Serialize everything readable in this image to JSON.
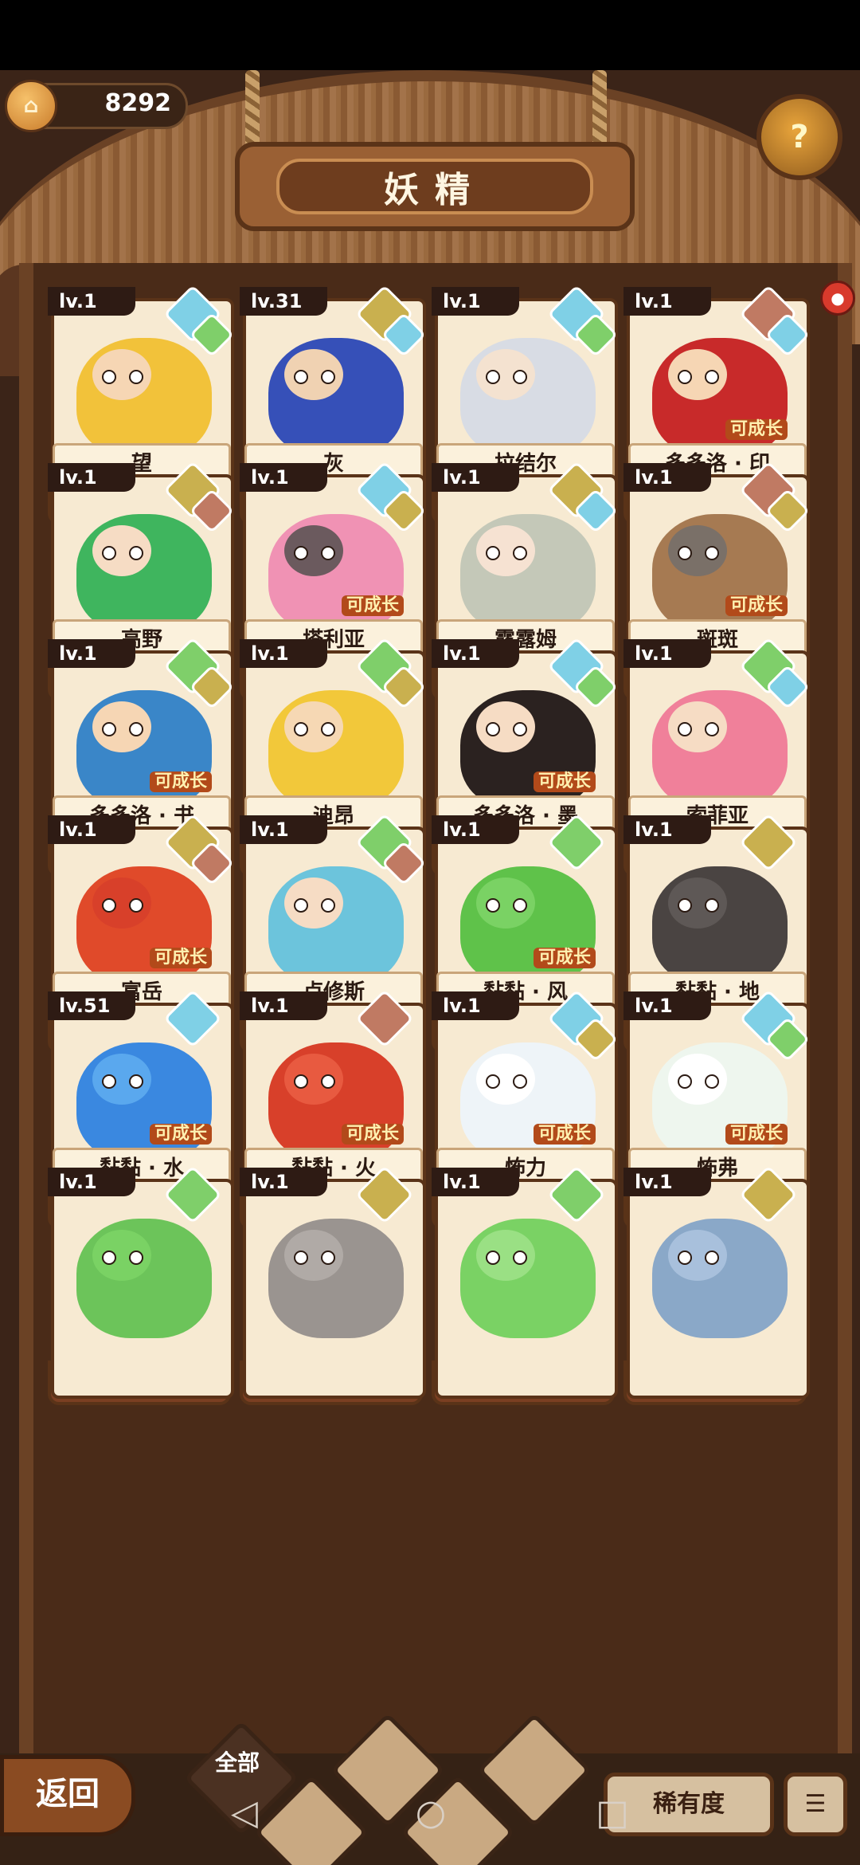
{
  "header": {
    "coins": "8292",
    "title": "妖精",
    "help_icon": "question-sprout-icon"
  },
  "colors": {
    "wood": "#8a5a33",
    "card": "#f7ead2",
    "star": "#ffd447",
    "water": "#7fd0e6",
    "earth": "#c9b04f",
    "grass": "#7fcf6a",
    "fire": "#c07a63"
  },
  "cards": [
    {
      "level": "lv.1",
      "name": "望",
      "stars": "★★★★★",
      "grow": "",
      "hair": "#f2c23a",
      "skin": "#f6d6b4",
      "e1": "water",
      "e2": "grass"
    },
    {
      "level": "lv.31",
      "name": "灰",
      "stars": "★★★★★",
      "grow": "",
      "hair": "#3650b8",
      "skin": "#f0d2b2",
      "e1": "earth",
      "e2": "water"
    },
    {
      "level": "lv.1",
      "name": "拉结尔",
      "stars": "★★★★★",
      "grow": "",
      "hair": "#d8dce4",
      "skin": "#f4e2d0",
      "e1": "water",
      "e2": "grass"
    },
    {
      "level": "lv.1",
      "name": "多多洛 · 印",
      "stars": "★★★★",
      "grow": "可成长",
      "hair": "#c82a2a",
      "skin": "#f6d6b4",
      "e1": "fire",
      "e2": "water"
    },
    {
      "level": "lv.1",
      "name": "高野",
      "stars": "★★★★",
      "grow": "",
      "hair": "#3fb55e",
      "skin": "#f6dcc4",
      "e1": "earth",
      "e2": "fire"
    },
    {
      "level": "lv.1",
      "name": "塔利亚",
      "stars": "★★★★",
      "grow": "可成长",
      "hair": "#f092b4",
      "skin": "#6b5a5e",
      "e1": "water",
      "e2": "earth"
    },
    {
      "level": "lv.1",
      "name": "露露姆",
      "stars": "★★★★",
      "grow": "",
      "hair": "#c4c8b8",
      "skin": "#f6e2d2",
      "e1": "earth",
      "e2": "water"
    },
    {
      "level": "lv.1",
      "name": "斑斑",
      "stars": "★★★★",
      "grow": "可成长",
      "hair": "#a67a52",
      "skin": "#7a7068",
      "e1": "fire",
      "e2": "earth"
    },
    {
      "level": "lv.1",
      "name": "多多洛 · 书",
      "stars": "★★★",
      "grow": "可成长",
      "hair": "#3a86c8",
      "skin": "#f6d6b4",
      "e1": "grass",
      "e2": "earth"
    },
    {
      "level": "lv.1",
      "name": "迪昂",
      "stars": "★★★",
      "grow": "",
      "hair": "#f2c83a",
      "skin": "#f6d8b4",
      "e1": "grass",
      "e2": "earth"
    },
    {
      "level": "lv.1",
      "name": "多多洛 · 墨",
      "stars": "★★★",
      "grow": "可成长",
      "hair": "#2b2220",
      "skin": "#f6dcc4",
      "e1": "water",
      "e2": "grass"
    },
    {
      "level": "lv.1",
      "name": "索菲亚",
      "stars": "★★★",
      "grow": "",
      "hair": "#f0809a",
      "skin": "#f6dcc4",
      "e1": "grass",
      "e2": "water"
    },
    {
      "level": "lv.1",
      "name": "富岳",
      "stars": "★★★",
      "grow": "可成长",
      "hair": "#e04a2a",
      "skin": "#d8402a",
      "e1": "earth",
      "e2": "fire"
    },
    {
      "level": "lv.1",
      "name": "卢修斯",
      "stars": "★★★",
      "grow": "",
      "hair": "#6cc4dc",
      "skin": "#f6dcc4",
      "e1": "grass",
      "e2": "fire"
    },
    {
      "level": "lv.1",
      "name": "黏黏 · 风",
      "stars": "★★",
      "grow": "可成长",
      "hair": "#5fc24a",
      "skin": "#7ad264",
      "e1": "grass",
      "e2": ""
    },
    {
      "level": "lv.1",
      "name": "黏黏 · 地",
      "stars": "★★",
      "grow": "",
      "hair": "#4a4442",
      "skin": "#5e5856",
      "e1": "earth",
      "e2": ""
    },
    {
      "level": "lv.51",
      "name": "黏黏 · 水",
      "stars": "★★",
      "grow": "可成长",
      "hair": "#3a88e0",
      "skin": "#5aa8ee",
      "e1": "water",
      "e2": ""
    },
    {
      "level": "lv.1",
      "name": "黏黏 · 火",
      "stars": "★★",
      "grow": "可成长",
      "hair": "#d8402a",
      "skin": "#e85a40",
      "e1": "fire",
      "e2": ""
    },
    {
      "level": "lv.1",
      "name": "怖力",
      "stars": "★★",
      "grow": "可成长",
      "hair": "#eef4f8",
      "skin": "#ffffff",
      "e1": "water",
      "e2": "earth"
    },
    {
      "level": "lv.1",
      "name": "怖弗",
      "stars": "★★",
      "grow": "可成长",
      "hair": "#eef6ee",
      "skin": "#ffffff",
      "e1": "water",
      "e2": "grass"
    },
    {
      "level": "lv.1",
      "name": "",
      "stars": "",
      "grow": "",
      "hair": "#6cc45a",
      "skin": "#7ad264",
      "e1": "grass",
      "e2": ""
    },
    {
      "level": "lv.1",
      "name": "",
      "stars": "",
      "grow": "",
      "hair": "#9a9490",
      "skin": "#b0aaa6",
      "e1": "earth",
      "e2": ""
    },
    {
      "level": "lv.1",
      "name": "",
      "stars": "",
      "grow": "",
      "hair": "#7ad264",
      "skin": "#9ae084",
      "e1": "grass",
      "e2": ""
    },
    {
      "level": "lv.1",
      "name": "",
      "stars": "",
      "grow": "",
      "hair": "#8aa8c8",
      "skin": "#a8c0dc",
      "e1": "earth",
      "e2": ""
    }
  ],
  "bottom": {
    "back_label": "返回",
    "tab_all": "全部",
    "rarity": "稀有度",
    "sort_icon": "sort-icon"
  },
  "nav": {
    "back": "◁",
    "home": "○",
    "recent": "□"
  }
}
